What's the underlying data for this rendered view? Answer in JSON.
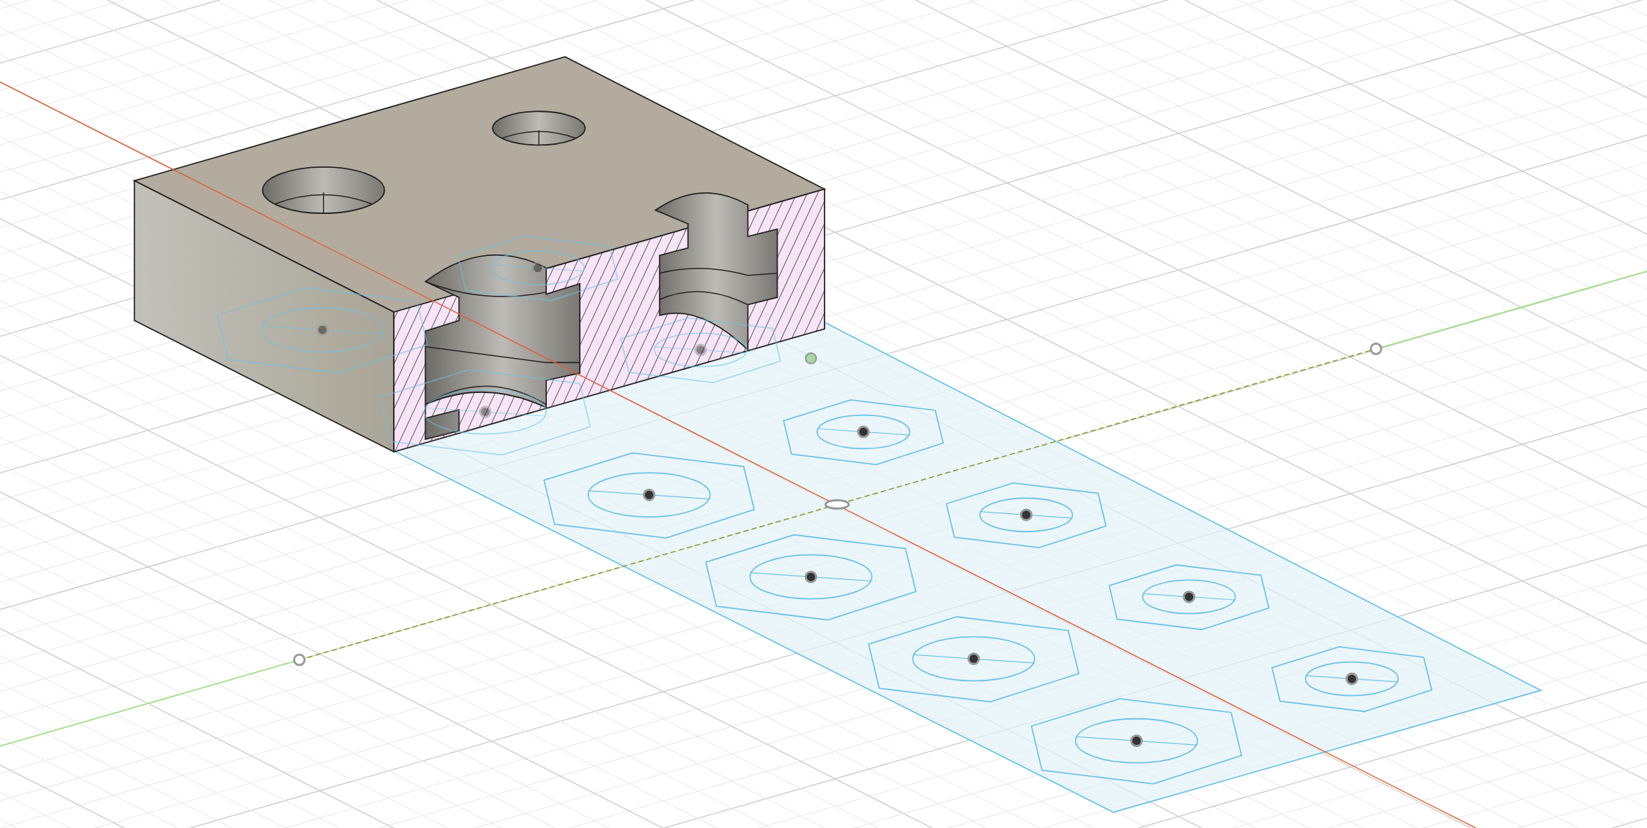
{
  "viewport": {
    "grid": true,
    "sketch_visible": true,
    "section_analysis": true
  }
}
